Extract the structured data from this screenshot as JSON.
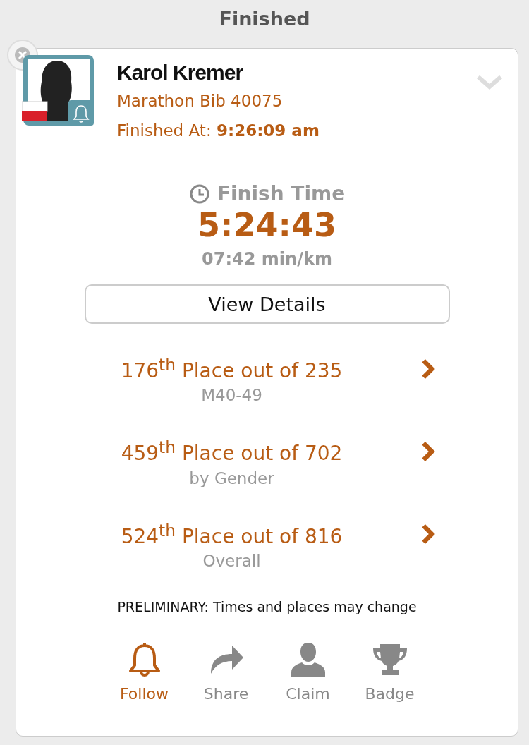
{
  "header": {
    "title": "Finished"
  },
  "runner": {
    "name": "Karol Kremer",
    "bib": "Marathon Bib 40075",
    "finished_label": "Finished At:",
    "finished_time": "9:26:09 am",
    "expanded": false
  },
  "result": {
    "label": "Finish Time",
    "time": "5:24:43",
    "pace": "07:42 min/km"
  },
  "details_button": "View Details",
  "places": [
    {
      "text": "176$^{th}$ Place out of 235",
      "category": "M40-49"
    },
    {
      "text": "459$^{th}$ Place out of 702",
      "category": "by Gender"
    },
    {
      "text": "524$^{th}$ Place out of 816",
      "category": "Overall"
    }
  ],
  "notice": "PRELIMINARY: Times and places may change",
  "actions": [
    {
      "kind": "follow",
      "label": "Follow",
      "selected": true
    },
    {
      "kind": "share",
      "label": "Share",
      "selected": false
    },
    {
      "kind": "claim",
      "label": "Claim",
      "selected": false
    },
    {
      "kind": "badge",
      "label": "Badge",
      "selected": false
    }
  ]
}
